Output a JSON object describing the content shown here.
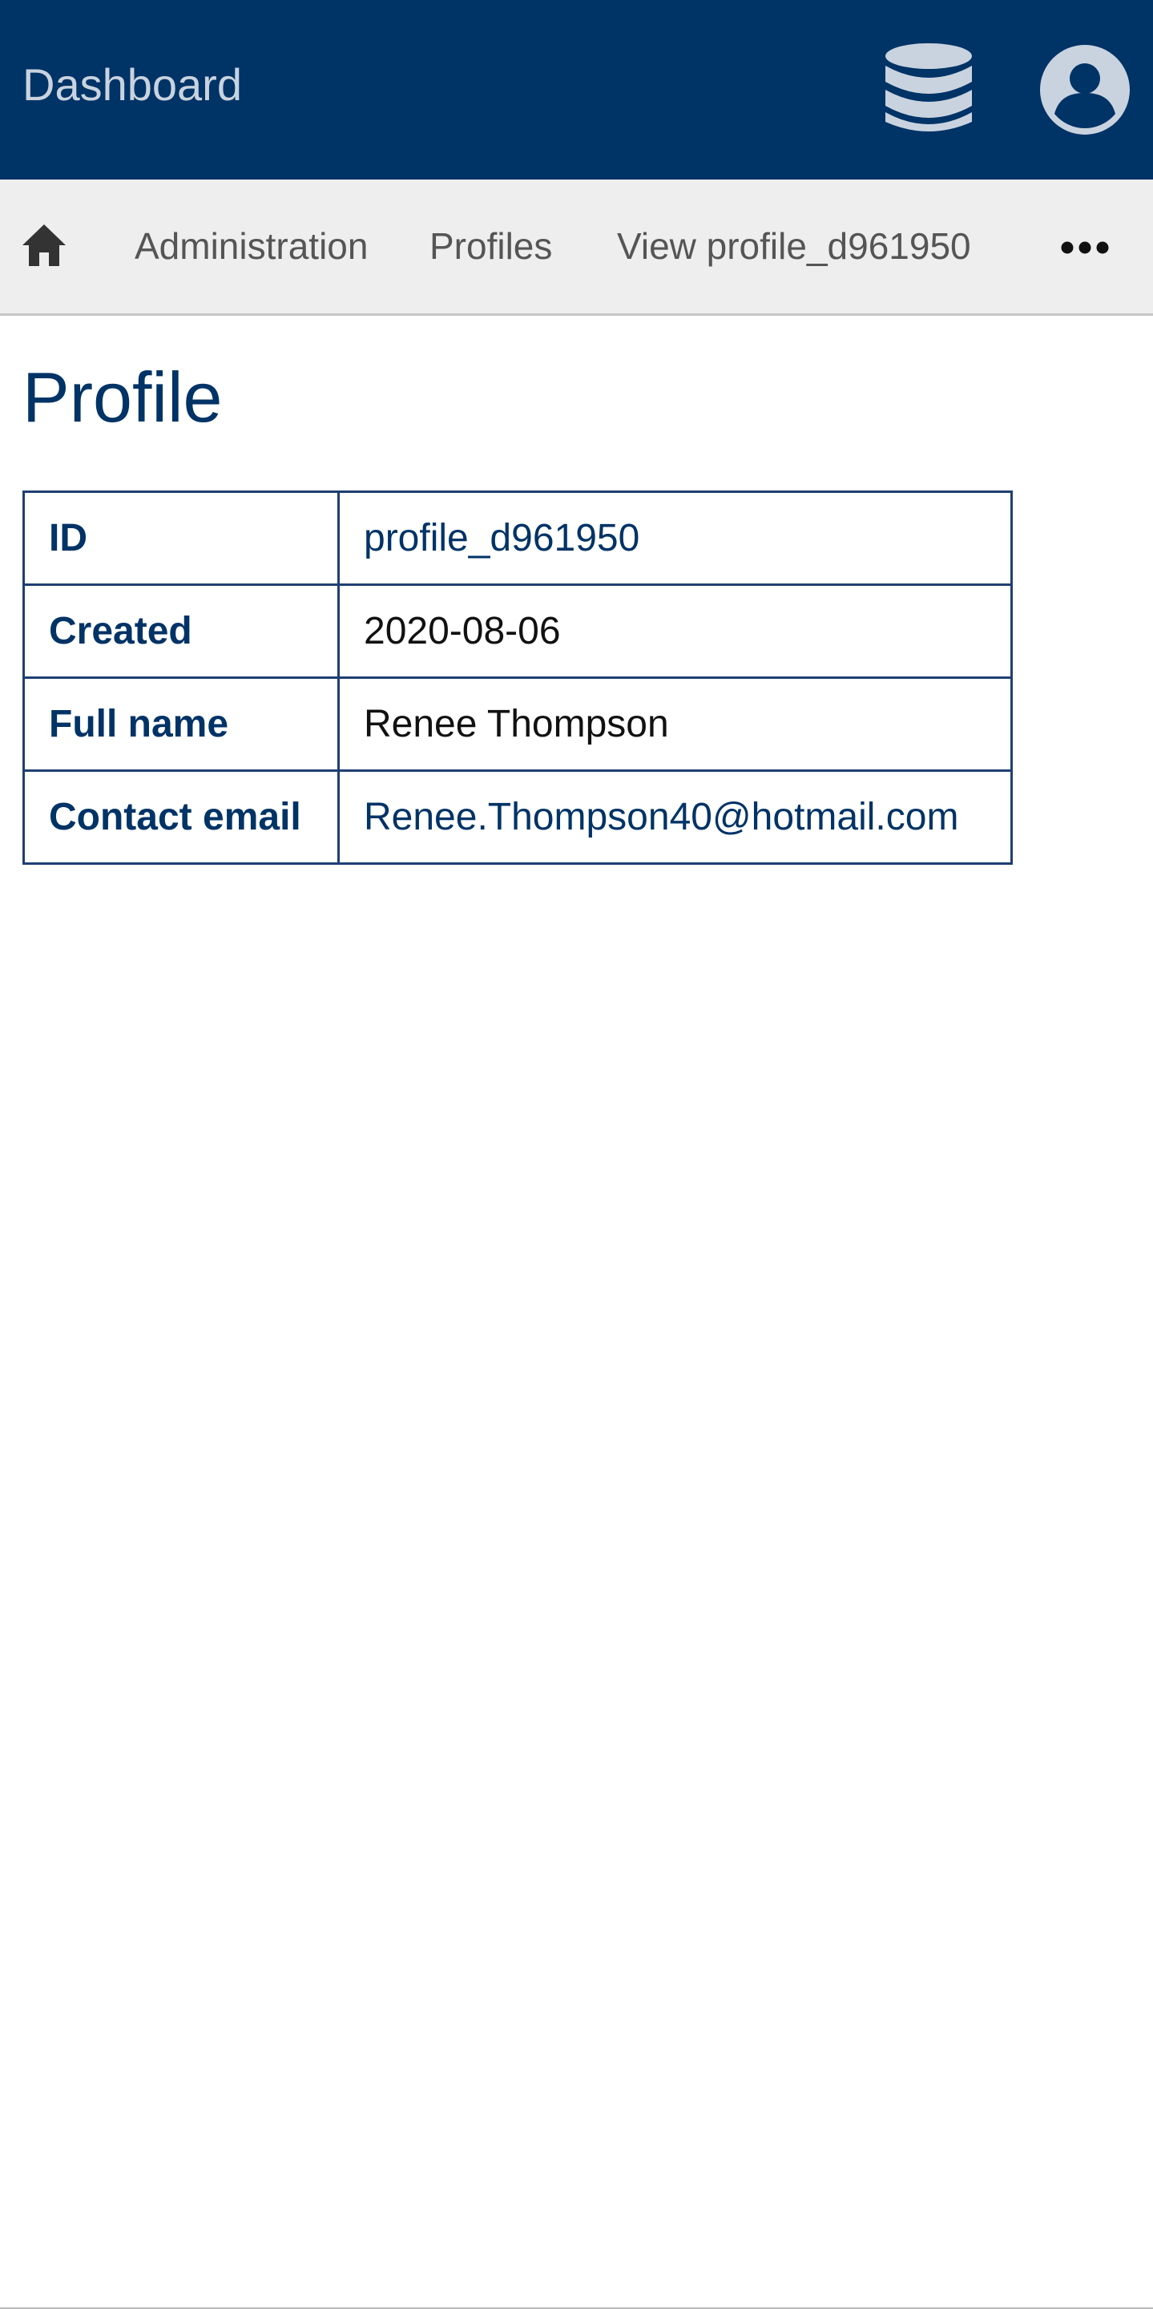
{
  "header": {
    "app_title": "Dashboard",
    "database_icon": "database-icon",
    "user_icon": "user-account-icon",
    "background_color": "#003366"
  },
  "breadcrumb": {
    "home_icon": "home-icon",
    "items": [
      {
        "label": "Administration"
      },
      {
        "label": "Profiles"
      },
      {
        "label": "View profile_d961950"
      }
    ],
    "more_icon": "more-horizontal-icon"
  },
  "main": {
    "title": "Profile",
    "details": [
      {
        "key": "ID",
        "value": "profile_d961950"
      },
      {
        "key": "Created",
        "value": "2020-08-06"
      },
      {
        "key": "Full name",
        "value": "Renee Thompson"
      },
      {
        "key": "Contact email",
        "value": "Renee.Thompson40@hotmail.com"
      }
    ]
  }
}
